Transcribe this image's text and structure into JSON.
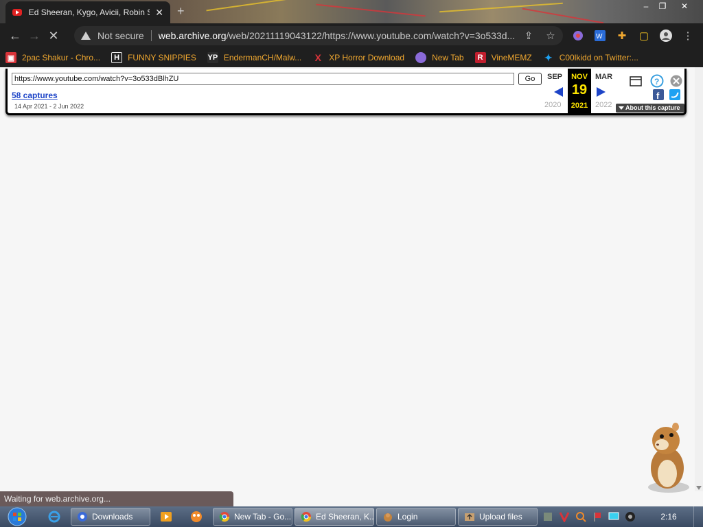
{
  "browser": {
    "tab_title": "Ed Sheeran, Kygo, Avicii, Robin S",
    "security_label": "Not secure",
    "url_host": "web.archive.org",
    "url_path": "/web/20211119043122/https://www.youtube.com/watch?v=3o533d..."
  },
  "bookmarks": [
    {
      "label": "2pac Shakur - Chro...",
      "icon": "gift-icon",
      "color": "#d8343a"
    },
    {
      "label": "FUNNY SNIPPIES",
      "icon": "h-icon",
      "color": "#222222"
    },
    {
      "label": "EndermanCH/Malw...",
      "icon": "yp-icon",
      "color": "#2b2b2b"
    },
    {
      "label": "XP Horror Download",
      "icon": "x-icon",
      "color": "#d8343a"
    },
    {
      "label": "New Tab",
      "icon": "globe-icon",
      "color": "#8a6ad8"
    },
    {
      "label": "VineMEMZ",
      "icon": "r-icon",
      "color": "#c01e2e"
    },
    {
      "label": "C00lkidd on Twitter:...",
      "icon": "twitter-icon",
      "color": "#1da1f2"
    }
  ],
  "wayback": {
    "url_value": "https://www.youtube.com/watch?v=3o533dBlhZU",
    "go_label": "Go",
    "captures": "58 captures",
    "range": "14 Apr 2021 - 2 Jun 2022",
    "prev_month": "SEP",
    "prev_year": "2020",
    "cur_month": "NOV",
    "cur_day": "19",
    "cur_year": "2021",
    "next_month": "MAR",
    "next_year": "2022",
    "about": "About this capture"
  },
  "status": "Waiting for web.archive.org...",
  "taskbar": {
    "items": [
      {
        "label": "Downloads"
      },
      {
        "label": "New Tab - Go..."
      },
      {
        "label": "Ed Sheeran, K..."
      },
      {
        "label": "Login"
      },
      {
        "label": "Upload files"
      }
    ],
    "clock": "2:16 AM"
  },
  "colors": {
    "accent_yellow": "#ffe600",
    "link_blue": "#1d44c7",
    "bookmark_orange": "#f0a830"
  }
}
